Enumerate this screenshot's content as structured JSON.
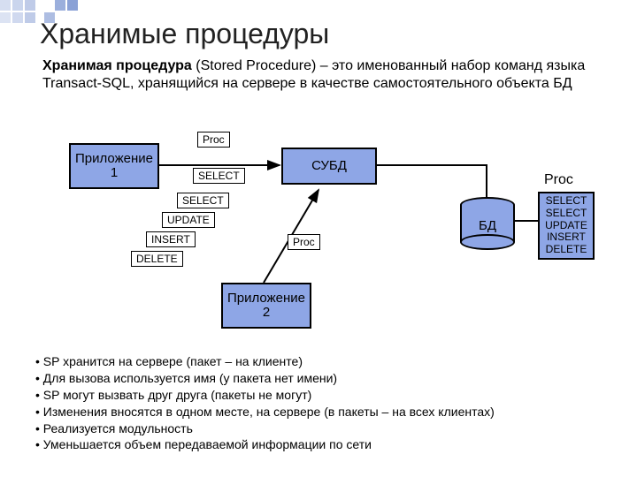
{
  "title": "Хранимые процедуры",
  "defn": {
    "term": "Хранимая процедура",
    "rest": " (Stored Procedure) – это именованный набор команд языка Transact-SQL, хранящийся на сервере в качестве самостоятельного объекта БД"
  },
  "boxes": {
    "app1": "Приложение 1",
    "app2": "Приложение 2",
    "dbms": "СУБД",
    "db": "БД"
  },
  "labels": {
    "proc1": "Proc",
    "select1": "SELECT",
    "select2": "SELECT",
    "update": "UPDATE",
    "insert": "INSERT",
    "delete": "DELETE",
    "proc2": "Proc"
  },
  "proc": {
    "title": "Proc",
    "ops": [
      "SELECT",
      "SELECT",
      "UPDATE",
      "INSERT",
      "DELETE"
    ]
  },
  "bullets": [
    "SP хранится на сервере (пакет – на клиенте)",
    "Для вызова используется имя (у пакета нет имени)",
    "SP могут вызвать друг друга (пакеты не могут)",
    "Изменения вносятся в одном месте, на сервере (в пакеты – на всех клиентах)",
    "Реализуется модульность",
    "Уменьшается объем передаваемой информации по сети"
  ]
}
